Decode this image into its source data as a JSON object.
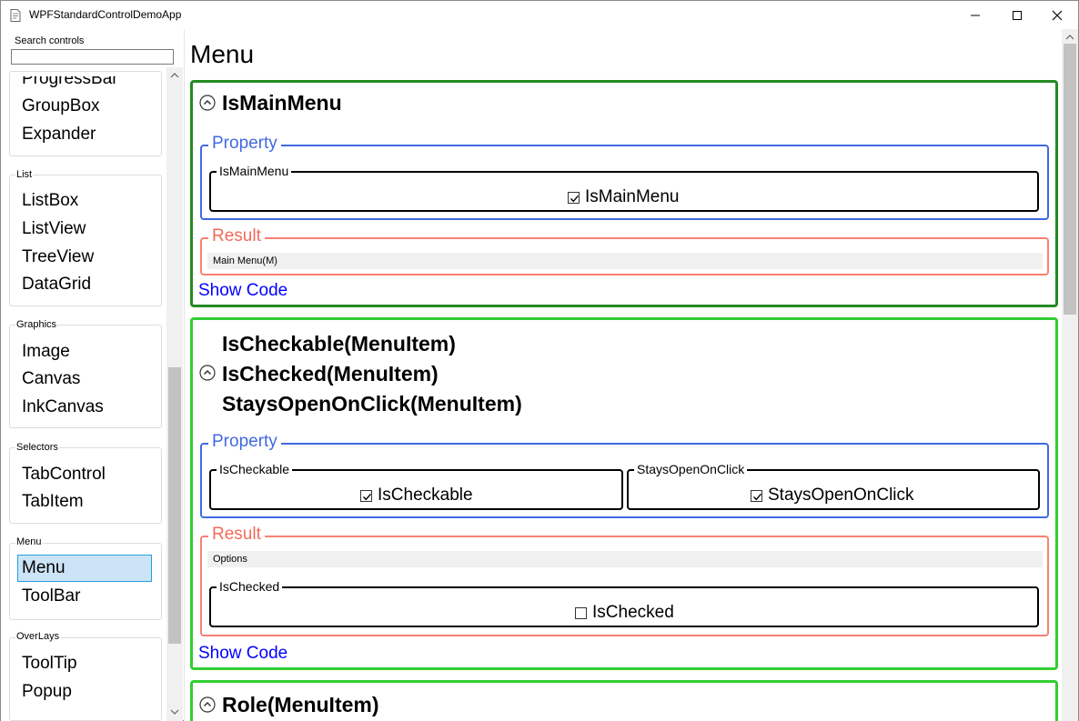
{
  "window": {
    "title": "WPFStandardControlDemoApp"
  },
  "sidebar": {
    "search_label": "Search controls",
    "search_value": "",
    "groups": [
      {
        "label": "",
        "items": [
          "ProgressBar",
          "GroupBox",
          "Expander"
        ]
      },
      {
        "label": "List",
        "items": [
          "ListBox",
          "ListView",
          "TreeView",
          "DataGrid"
        ]
      },
      {
        "label": "Graphics",
        "items": [
          "Image",
          "Canvas",
          "InkCanvas"
        ]
      },
      {
        "label": "Selectors",
        "items": [
          "TabControl",
          "TabItem"
        ]
      },
      {
        "label": "Menu",
        "items": [
          "Menu",
          "ToolBar"
        ]
      },
      {
        "label": "OverLays",
        "items": [
          "ToolTip",
          "Popup"
        ]
      }
    ],
    "selected": "Menu"
  },
  "main": {
    "title": "Menu",
    "cards": [
      {
        "heading": [
          "IsMainMenu"
        ],
        "property_label": "Property",
        "props": [
          {
            "legend": "IsMainMenu",
            "check_label": "IsMainMenu",
            "checked": true
          }
        ],
        "result_label": "Result",
        "result_text": "Main Menu(M)",
        "show_code": "Show Code"
      },
      {
        "heading": [
          "IsCheckable(MenuItem)",
          "IsChecked(MenuItem)",
          "StaysOpenOnClick(MenuItem)"
        ],
        "property_label": "Property",
        "props": [
          {
            "legend": "IsCheckable",
            "check_label": "IsCheckable",
            "checked": true
          },
          {
            "legend": "StaysOpenOnClick",
            "check_label": "StaysOpenOnClick",
            "checked": true
          }
        ],
        "result_label": "Result",
        "result_text": "Options",
        "result_sub": {
          "legend": "IsChecked",
          "check_label": "IsChecked",
          "checked": false
        },
        "show_code": "Show Code"
      },
      {
        "heading": [
          "Role(MenuItem)"
        ]
      }
    ]
  },
  "colors": {
    "card_dark": "#228b22",
    "card_light": "#32cd32",
    "property": "#4169e1",
    "result": "#fa8072",
    "link": "#0000ff",
    "selection": "#cce4f7"
  }
}
